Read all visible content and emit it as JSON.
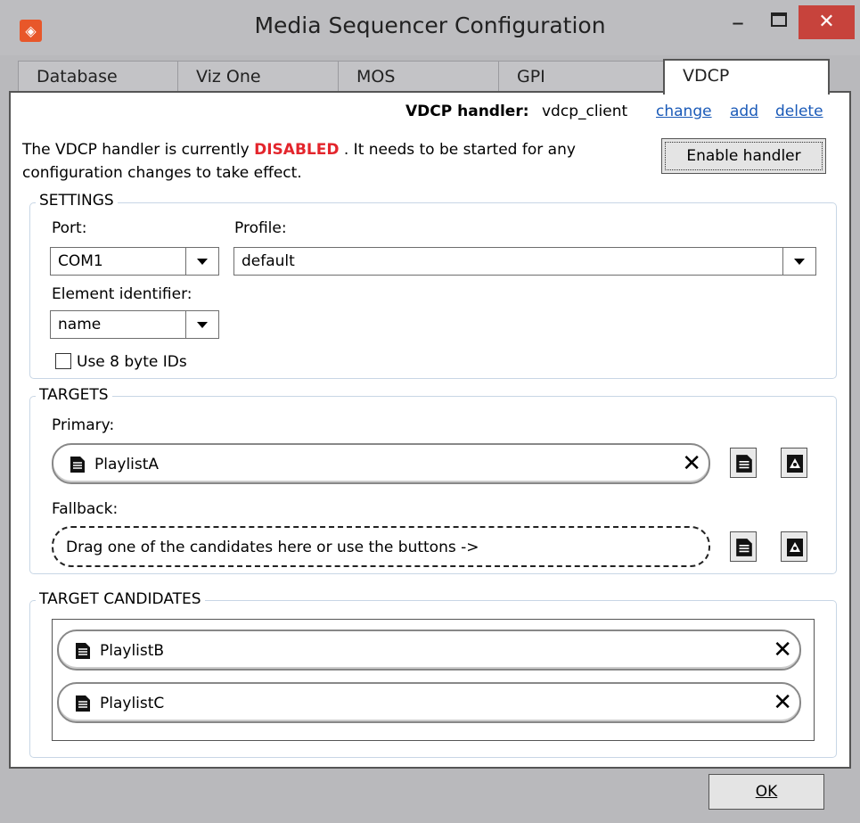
{
  "window": {
    "title": "Media Sequencer Configuration",
    "app_icon_glyph": "◈",
    "minimize_glyph": "–",
    "close_glyph": "✕",
    "accent_color": "#c7433c"
  },
  "tabs": [
    {
      "label": "Database",
      "active": false
    },
    {
      "label": "Viz One",
      "active": false
    },
    {
      "label": "MOS",
      "active": false
    },
    {
      "label": "GPI",
      "active": false
    },
    {
      "label": "VDCP",
      "active": true
    }
  ],
  "handler": {
    "label": "VDCP handler:",
    "value": "vdcp_client",
    "links": {
      "change": "change",
      "add": "add",
      "delete": "delete"
    }
  },
  "status": {
    "line1_prefix": "The VDCP handler is currently ",
    "state": "DISABLED",
    "state_color": "#e3252c",
    "line1_suffix": " . It needs to be started for any",
    "line2": "configuration changes to take effect.",
    "enable_button": "Enable handler"
  },
  "settings": {
    "legend": "SETTINGS",
    "port_label": "Port:",
    "port_value": "COM1",
    "profile_label": "Profile:",
    "profile_value": "default",
    "element_identifier_label": "Element identifier:",
    "element_identifier_value": "name",
    "use8byte_label": "Use 8 byte IDs",
    "use8byte_checked": false
  },
  "targets": {
    "legend": "TARGETS",
    "primary_label": "Primary:",
    "primary_value": "PlaylistA",
    "fallback_label": "Fallback:",
    "fallback_placeholder": "Drag one of the candidates here or use the buttons ->"
  },
  "candidates": {
    "legend": "TARGET CANDIDATES",
    "items": [
      "PlaylistB",
      "PlaylistC"
    ]
  },
  "remove_glyph": "✕",
  "footer": {
    "ok_label": "OK"
  }
}
